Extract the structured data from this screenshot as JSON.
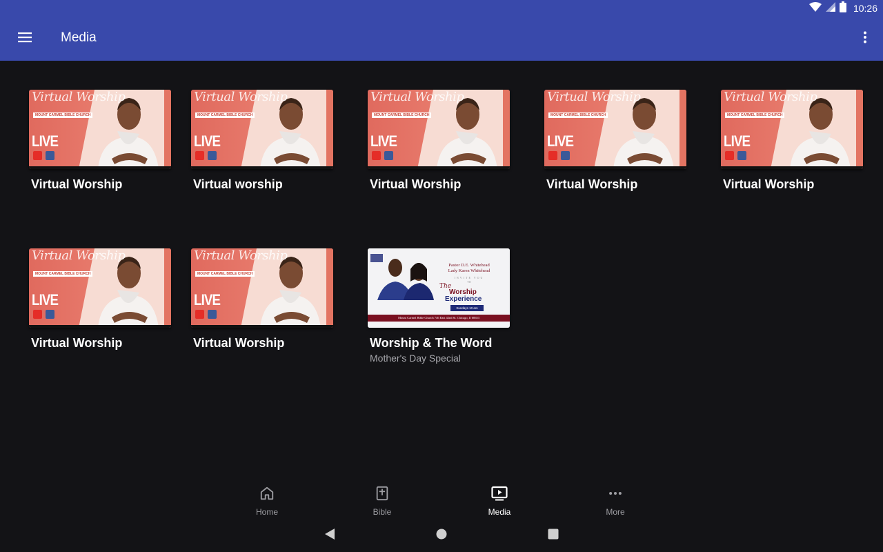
{
  "status_bar": {
    "time": "10:26"
  },
  "app_bar": {
    "title": "Media"
  },
  "media_items": [
    {
      "title": "Virtual Worship",
      "subtitle": "",
      "thumb_title": "Virtual Worship",
      "thumb_church": "MOUNT CARMEL BIBLE CHURCH",
      "thumb_badge": "LIVE"
    },
    {
      "title": "Virtual worship",
      "subtitle": "",
      "thumb_title": "Virtual Worship",
      "thumb_church": "MOUNT CARMEL BIBLE CHURCH",
      "thumb_badge": "LIVE"
    },
    {
      "title": "Virtual Worship",
      "subtitle": "",
      "thumb_title": "Virtual Worship",
      "thumb_church": "MOUNT CARMEL BIBLE CHURCH",
      "thumb_badge": "LIVE"
    },
    {
      "title": "Virtual Worship",
      "subtitle": "",
      "thumb_title": "Virtual Worship",
      "thumb_church": "MOUNT CARMEL BIBLE CHURCH",
      "thumb_badge": "LIVE"
    },
    {
      "title": "Virtual Worship",
      "subtitle": "",
      "thumb_title": "Virtual Worship",
      "thumb_church": "MOUNT CARMEL BIBLE CHURCH",
      "thumb_badge": "LIVE"
    },
    {
      "title": "Virtual Worship",
      "subtitle": "",
      "thumb_title": "Virtual Worship",
      "thumb_church": "MOUNT CARMEL BIBLE CHURCH",
      "thumb_badge": "LIVE"
    },
    {
      "title": "Virtual Worship",
      "subtitle": "",
      "thumb_title": "Virtual Worship",
      "thumb_church": "MOUNT CARMEL BIBLE CHURCH",
      "thumb_badge": "LIVE"
    },
    {
      "title": "Worship & The Word",
      "subtitle": "Mother's Day Special",
      "flyer": {
        "names_1": "Pastor D.E. Whitehead",
        "names_2": "Lady Karen Whitehead",
        "invite": "INVITE YOU",
        "to": "TO",
        "the": "The",
        "event_1": "Worship",
        "event_2": "Experience",
        "time": "Sundays 10 am",
        "footer": "Mount Carmel Bible Church 746 East 42nd St. Chicago, Il 60653"
      }
    }
  ],
  "bottom_nav": [
    {
      "label": "Home",
      "icon": "home-icon",
      "active": false
    },
    {
      "label": "Bible",
      "icon": "bible-icon",
      "active": false
    },
    {
      "label": "Media",
      "icon": "media-icon",
      "active": true
    },
    {
      "label": "More",
      "icon": "more-horiz-icon",
      "active": false
    }
  ],
  "colors": {
    "primary": "#3949ab",
    "background": "#131316",
    "thumb_coral": "#e8766a",
    "flyer_maroon": "#7a1020",
    "flyer_navy": "#1e2a78"
  }
}
